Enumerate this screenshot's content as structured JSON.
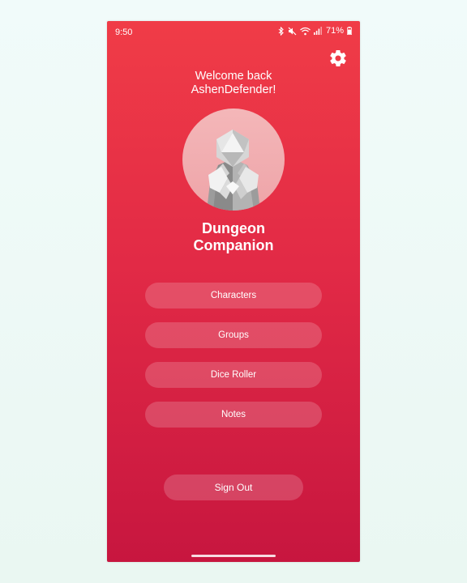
{
  "status_bar": {
    "time": "9:50",
    "battery": "71%",
    "icons": [
      "bluetooth-icon",
      "mute-icon",
      "wifi-icon",
      "signal-icon",
      "battery-icon"
    ]
  },
  "header": {
    "settings_icon": "gear-icon",
    "welcome_line1": "Welcome back",
    "welcome_line2": "AshenDefender!"
  },
  "app": {
    "title_line1": "Dungeon",
    "title_line2": "Companion",
    "avatar": "dice-knight-avatar"
  },
  "menu": {
    "items": [
      {
        "label": "Characters"
      },
      {
        "label": "Groups"
      },
      {
        "label": "Dice Roller"
      },
      {
        "label": "Notes"
      }
    ]
  },
  "footer": {
    "signout_label": "Sign Out"
  },
  "colors": {
    "gradient_top": "#f03c47",
    "gradient_bottom": "#c7163f",
    "button_fill": "rgba(255,255,255,0.18)",
    "text": "#ffffff"
  }
}
